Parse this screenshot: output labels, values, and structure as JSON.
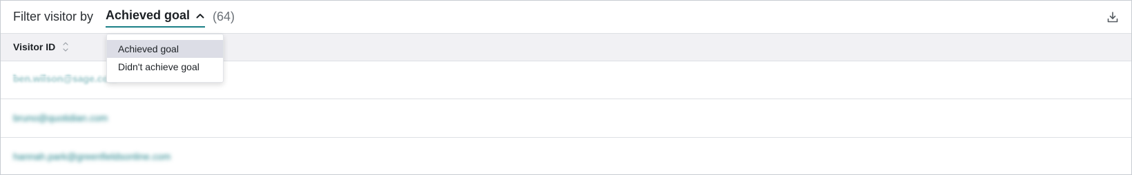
{
  "filter": {
    "label": "Filter visitor by",
    "selected": "Achieved goal",
    "count": "(64)"
  },
  "dropdown": {
    "options": [
      "Achieved goal",
      "Didn't achieve goal"
    ],
    "selected_index": 0
  },
  "table": {
    "columns": [
      {
        "label": "Visitor ID",
        "sortable": true
      }
    ],
    "rows": [
      {
        "visitor_id": "ben.wilson@sage.com"
      },
      {
        "visitor_id": "bruno@quotidian.com"
      },
      {
        "visitor_id": "hannah.park@greenfieldsonline.com"
      }
    ]
  },
  "icons": {
    "chevron": "chevron-up-icon",
    "download": "download-icon",
    "sort": "sort-icon"
  },
  "colors": {
    "accent": "#1a7f86",
    "header_bg": "#f1f1f4",
    "selected_option_bg": "#dcdde6"
  }
}
